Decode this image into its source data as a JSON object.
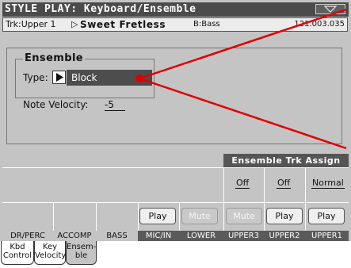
{
  "header": {
    "title": "STYLE PLAY: Keyboard/Ensemble",
    "menu_icon": "chevron-down-icon"
  },
  "track_info": {
    "track": "Trk:Upper 1",
    "arrow": "▷",
    "song": "Sweet Fretless",
    "bass": "B:Bass",
    "position": "121.003.035"
  },
  "ensemble": {
    "section_title": "Ensemble",
    "type_label": "Type:",
    "type_value": "Block",
    "velocity_label": "Note Velocity:",
    "velocity_value": "-5"
  },
  "assign": {
    "header": "Ensemble Trk Assign",
    "values": [
      "Off",
      "Off",
      "Normal"
    ]
  },
  "track_buttons": [
    {
      "label": "Play",
      "state": "play"
    },
    {
      "label": "Mute",
      "state": "mute"
    },
    {
      "label": "Mute",
      "state": "mute"
    },
    {
      "label": "Play",
      "state": "play"
    },
    {
      "label": "Play",
      "state": "play"
    }
  ],
  "track_names": [
    "DR/PERC",
    "ACCOMP",
    "BASS",
    "MIC/IN",
    "LOWER",
    "UPPER3",
    "UPPER2",
    "UPPER1"
  ],
  "tabs": [
    {
      "line1": "Kbd",
      "line2": "Control"
    },
    {
      "line1": "Key",
      "line2": "Velocity"
    },
    {
      "line1": "Ensem-",
      "line2": "ble"
    }
  ],
  "colors": {
    "pointer": "#e00000",
    "title_bar": "#4b4b4b"
  }
}
